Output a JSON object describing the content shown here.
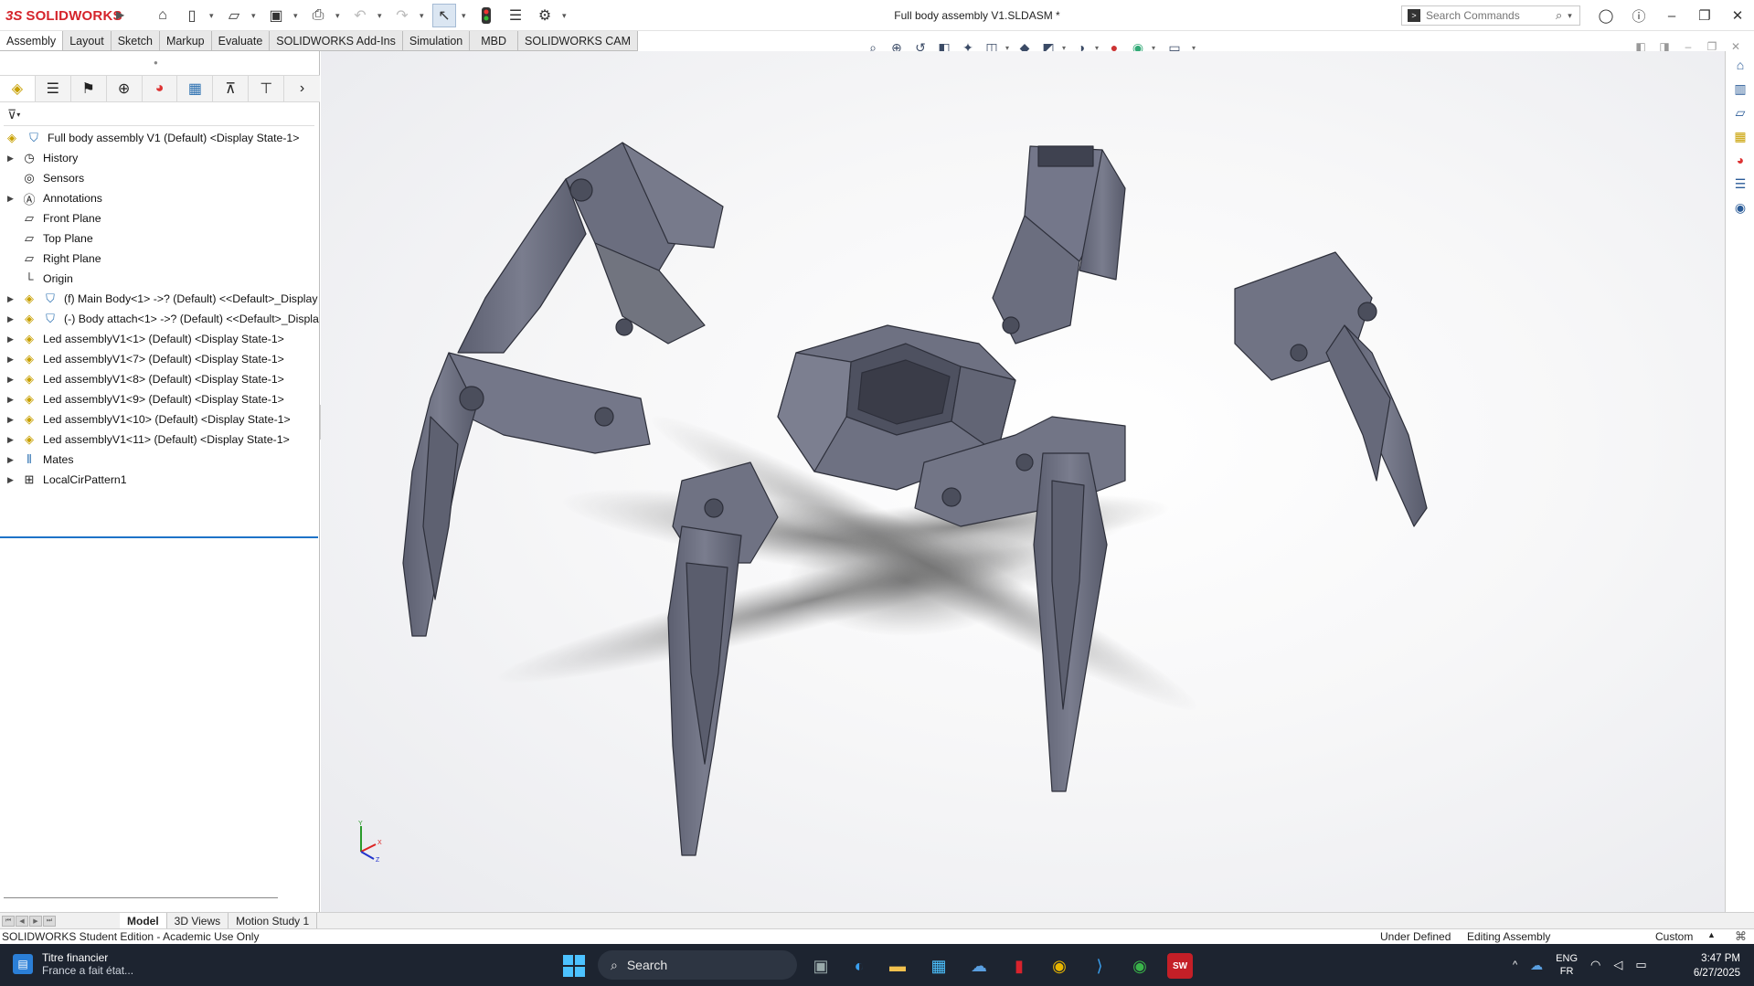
{
  "app": {
    "logo_ds": "3S",
    "logo_name": "SOLIDWORKS",
    "document_title": "Full body assembly V1.SLDASM *"
  },
  "search": {
    "placeholder": "Search Commands"
  },
  "quick_toolbar": [
    "home-icon",
    "new-document-icon",
    "open-icon",
    "save-icon",
    "print-icon",
    "undo-icon",
    "redo-icon",
    "select-icon",
    "rebuild-icon",
    "file-properties-icon",
    "options-icon"
  ],
  "command_tabs": [
    "Assembly",
    "Layout",
    "Sketch",
    "Markup",
    "Evaluate",
    "SOLIDWORKS Add-Ins",
    "Simulation",
    "MBD",
    "SOLIDWORKS CAM"
  ],
  "feature_tree": {
    "root": "Full body assembly V1 (Default) <Display State-1>",
    "items": [
      {
        "label": "History",
        "expandable": true
      },
      {
        "label": "Sensors",
        "expandable": false
      },
      {
        "label": "Annotations",
        "expandable": true
      },
      {
        "label": "Front Plane",
        "expandable": false
      },
      {
        "label": "Top Plane",
        "expandable": false
      },
      {
        "label": "Right Plane",
        "expandable": false
      },
      {
        "label": "Origin",
        "expandable": false
      },
      {
        "label": "(f) Main Body<1> ->? (Default) <<Default>_Display",
        "expandable": true
      },
      {
        "label": "(-) Body attach<1> ->? (Default) <<Default>_Displa",
        "expandable": true
      },
      {
        "label": "Led assemblyV1<1> (Default) <Display State-1>",
        "expandable": true
      },
      {
        "label": "Led assemblyV1<7> (Default) <Display State-1>",
        "expandable": true
      },
      {
        "label": "Led assemblyV1<8> (Default) <Display State-1>",
        "expandable": true
      },
      {
        "label": "Led assemblyV1<9> (Default) <Display State-1>",
        "expandable": true
      },
      {
        "label": "Led assemblyV1<10> (Default) <Display State-1>",
        "expandable": true
      },
      {
        "label": "Led assemblyV1<11> (Default) <Display State-1>",
        "expandable": true
      },
      {
        "label": "Mates",
        "expandable": true
      },
      {
        "label": "LocalCirPattern1",
        "expandable": true
      }
    ]
  },
  "triad": {
    "x": "X",
    "y": "Y",
    "z": "Z"
  },
  "bottom_tabs": [
    "Model",
    "3D Views",
    "Motion Study 1"
  ],
  "status": {
    "edition": "SOLIDWORKS Student Edition - Academic Use Only",
    "definition": "Under Defined",
    "mode": "Editing Assembly",
    "units": "Custom"
  },
  "taskbar": {
    "news_title": "Titre financier",
    "news_sub": "France a fait état...",
    "search_label": "Search",
    "lang_1": "ENG",
    "lang_2": "FR",
    "time": "3:47 PM",
    "date": "6/27/2025"
  },
  "colors": {
    "accent": "#d5242b",
    "taskbar": "#1d2430",
    "model": "#6c6f80",
    "selection": "#1e73c8"
  }
}
